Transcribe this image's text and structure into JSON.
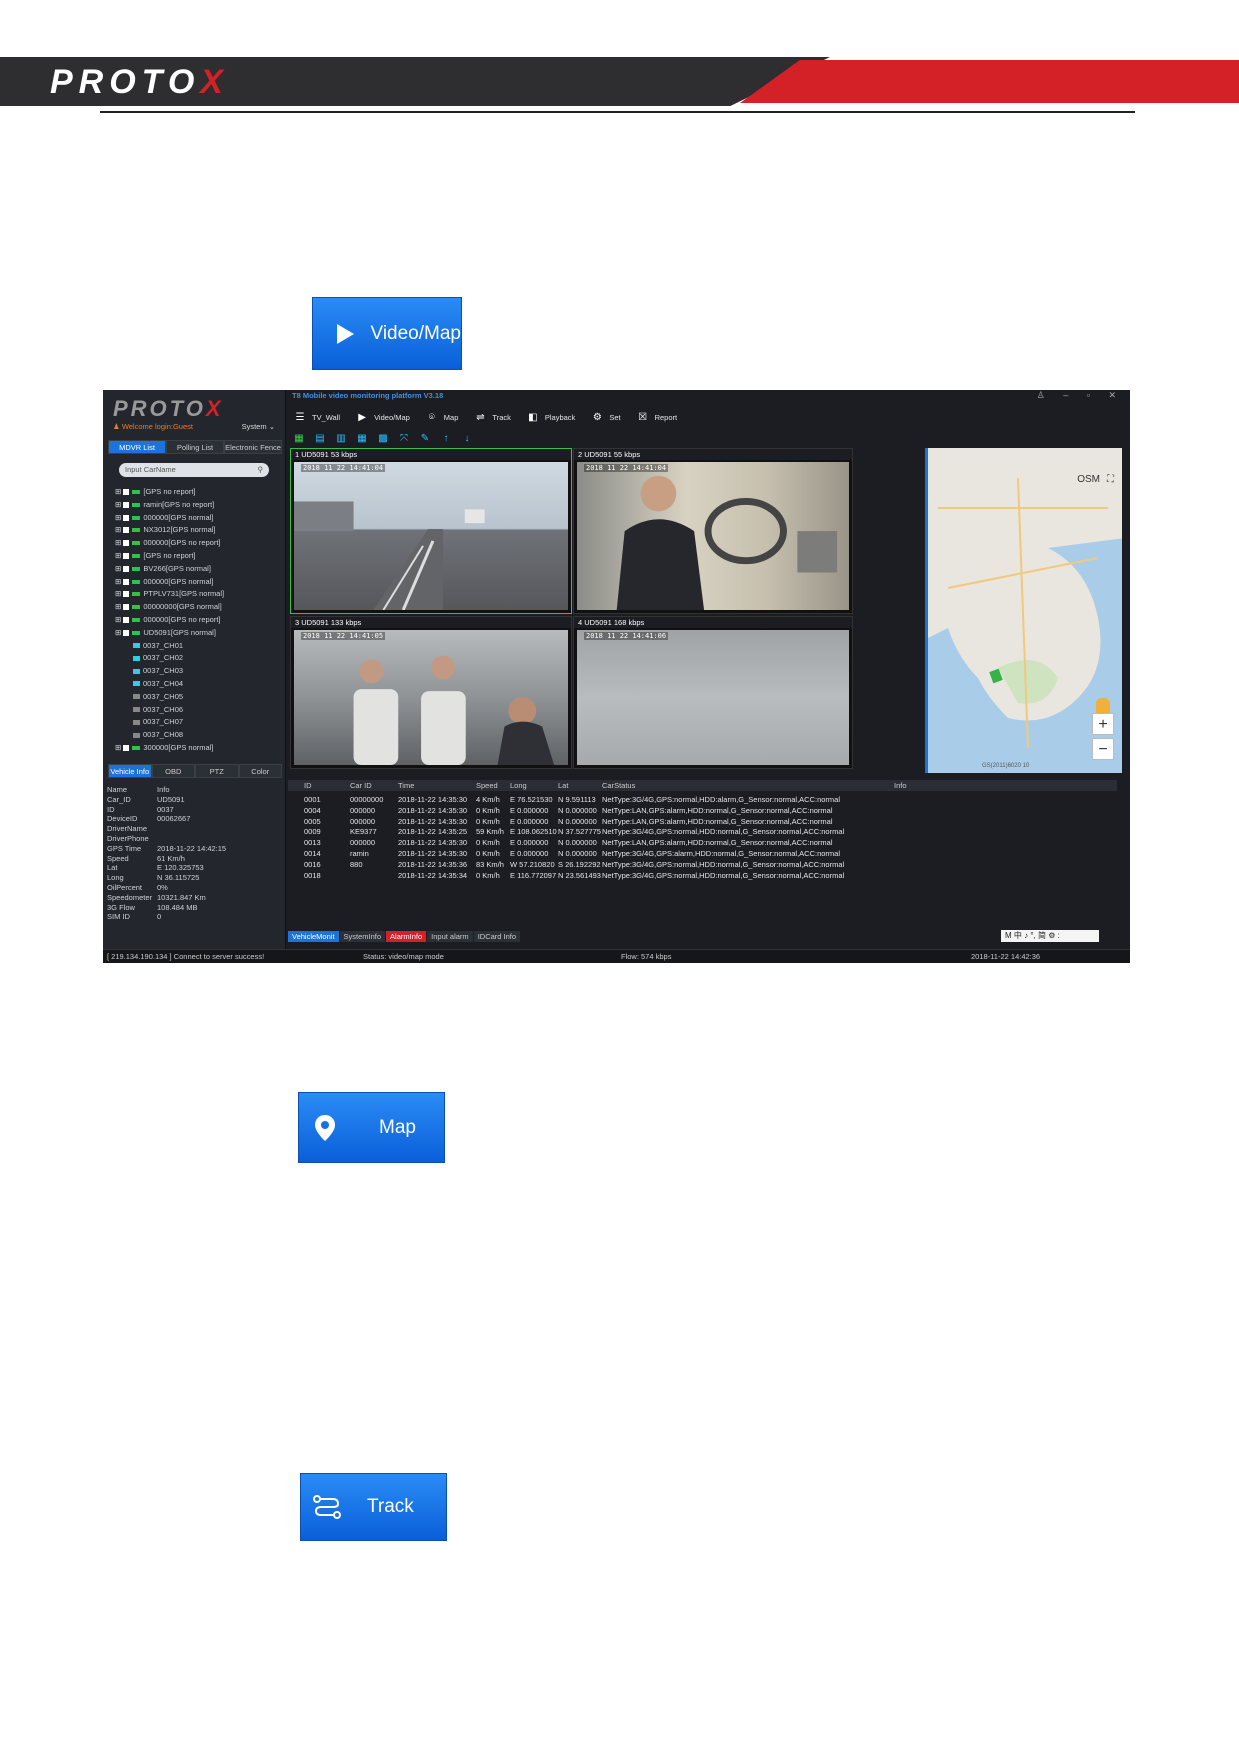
{
  "header": {
    "logo_main": "PROTO",
    "logo_x": "X"
  },
  "buttons": {
    "video_map": "Video/Map",
    "map": "Map",
    "track": "Track"
  },
  "app": {
    "logo_main": "PROTO",
    "logo_x": "X",
    "title": "T8 Mobile video monitoring platform V3.18",
    "welcome": "Welcome login:Guest",
    "system": "System",
    "left_tabs": [
      "MDVR List",
      "Polling List",
      "Electronic Fence"
    ],
    "search_placeholder": "Input CarName",
    "tree": [
      {
        "label": "[GPS no report]",
        "type": "car"
      },
      {
        "label": "ramin[GPS no report]",
        "type": "car"
      },
      {
        "label": "000000[GPS normal]",
        "type": "car"
      },
      {
        "label": "NX3012[GPS normal]",
        "type": "car"
      },
      {
        "label": "000000[GPS no report]",
        "type": "car"
      },
      {
        "label": "[GPS no report]",
        "type": "car"
      },
      {
        "label": "BV266[GPS normal]",
        "type": "car"
      },
      {
        "label": "000000[GPS normal]",
        "type": "car"
      },
      {
        "label": "PTPLV731[GPS normal]",
        "type": "car"
      },
      {
        "label": "00000000[GPS normal]",
        "type": "car"
      },
      {
        "label": "000000[GPS no report]",
        "type": "car"
      },
      {
        "label": "UD5091[GPS normal]",
        "type": "car"
      },
      {
        "label": "0037_CH01",
        "type": "cam"
      },
      {
        "label": "0037_CH02",
        "type": "cam"
      },
      {
        "label": "0037_CH03",
        "type": "cam"
      },
      {
        "label": "0037_CH04",
        "type": "cam"
      },
      {
        "label": "0037_CH05",
        "type": "camoff"
      },
      {
        "label": "0037_CH06",
        "type": "camoff"
      },
      {
        "label": "0037_CH07",
        "type": "camoff"
      },
      {
        "label": "0037_CH08",
        "type": "camoff"
      },
      {
        "label": "300000[GPS normal]",
        "type": "car"
      }
    ],
    "vehicle_tabs": [
      "Vehicle Info",
      "OBD",
      "PTZ",
      "Color"
    ],
    "info_header": {
      "k": "Name",
      "v": "Info"
    },
    "info": [
      {
        "k": "Car_ID",
        "v": "UD5091"
      },
      {
        "k": "ID",
        "v": "0037"
      },
      {
        "k": "DeviceID",
        "v": "00062667"
      },
      {
        "k": "DriverName",
        "v": ""
      },
      {
        "k": "DriverPhone",
        "v": ""
      },
      {
        "k": "GPS Time",
        "v": "2018-11-22 14:42:15"
      },
      {
        "k": "Speed",
        "v": "61 Km/h"
      },
      {
        "k": "Lat",
        "v": "E 120.325753"
      },
      {
        "k": "Long",
        "v": "N 36.115725"
      },
      {
        "k": "OilPercent",
        "v": "0%"
      },
      {
        "k": "Speedometer",
        "v": "10321.847 Km"
      },
      {
        "k": "3G Flow",
        "v": "108.484 MB"
      },
      {
        "k": "SIM ID",
        "v": "0"
      }
    ],
    "toolbar": [
      "TV_Wall",
      "Video/Map",
      "Map",
      "Track",
      "Playback",
      "Set",
      "Report"
    ],
    "videos": [
      {
        "label": "1   UD5091   53 kbps",
        "stamp": "2018 11 22 14:41:04"
      },
      {
        "label": "2   UD5091   55 kbps",
        "stamp": "2018 11 22 14:41:04"
      },
      {
        "label": "3   UD5091   133 kbps",
        "stamp": "2018 11 22 14:41:05"
      },
      {
        "label": "4   UD5091   168 kbps",
        "stamp": "2018 11 22 14:41:06"
      }
    ],
    "map_label": "OSM",
    "grid_headers": [
      "ID",
      "Car ID",
      "Time",
      "Speed",
      "Long",
      "Lat",
      "CarStatus",
      "Info"
    ],
    "grid_rows": [
      [
        "0001",
        "00000000",
        "2018-11-22 14:35:30",
        "4 Km/h",
        "E 76.521530",
        "N 9.591113",
        "NetType:3G/4G,GPS:normal,HDD:alarm,G_Sensor:normal,ACC:normal"
      ],
      [
        "0004",
        "000000",
        "2018-11-22 14:35:30",
        "0 Km/h",
        "E 0.000000",
        "N 0.000000",
        "NetType:LAN,GPS:alarm,HDD:normal,G_Sensor:normal,ACC:normal"
      ],
      [
        "0005",
        "000000",
        "2018-11-22 14:35:30",
        "0 Km/h",
        "E 0.000000",
        "N 0.000000",
        "NetType:LAN,GPS:alarm,HDD:normal,G_Sensor:normal,ACC:normal"
      ],
      [
        "0009",
        "KE9377",
        "2018-11-22 14:35:25",
        "59 Km/h",
        "E 108.062510",
        "N 37.527775",
        "NetType:3G/4G,GPS:normal,HDD:normal,G_Sensor:normal,ACC:normal"
      ],
      [
        "0013",
        "000000",
        "2018-11-22 14:35:30",
        "0 Km/h",
        "E 0.000000",
        "N 0.000000",
        "NetType:LAN,GPS:alarm,HDD:normal,G_Sensor:normal,ACC:normal"
      ],
      [
        "0014",
        "ramin",
        "2018-11-22 14:35:30",
        "0 Km/h",
        "E 0.000000",
        "N 0.000000",
        "NetType:3G/4G,GPS:alarm,HDD:normal,G_Sensor:normal,ACC:normal"
      ],
      [
        "0016",
        "880",
        "2018-11-22 14:35:36",
        "83 Km/h",
        "W 57.210820",
        "S 26.192292",
        "NetType:3G/4G,GPS:normal,HDD:normal,G_Sensor:normal,ACC:normal"
      ],
      [
        "0018",
        "",
        "2018-11-22 14:35:34",
        "0 Km/h",
        "E 116.772097",
        "N 23.561493",
        "NetType:3G/4G,GPS:normal,HDD:normal,G_Sensor:normal,ACC:normal"
      ]
    ],
    "bottom_tabs": [
      "VehicleMonit",
      "SystemInfo",
      "AlarmInfo",
      "Input alarm",
      "IDCard Info"
    ],
    "ime": "M 中 ♪ °, 简 ⚙ :",
    "status": {
      "connect": "[ 219.134.190.134 ]  Connect to server success!",
      "mode": "Status: video/map mode",
      "flow": "Flow: 574 kbps",
      "time": "2018-11-22 14:42:36"
    },
    "map_copyright": "GS(2011)6020   10"
  }
}
